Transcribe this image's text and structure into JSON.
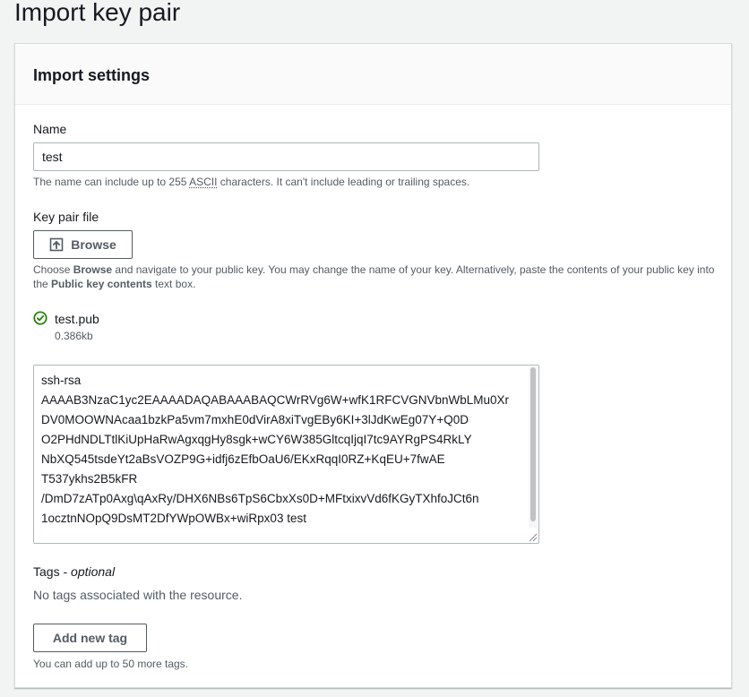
{
  "page": {
    "title": "Import key pair"
  },
  "settings": {
    "title": "Import settings"
  },
  "name_field": {
    "label": "Name",
    "value": "test",
    "hint_prefix": "The name can include up to 255 ",
    "hint_abbr": "ASCII",
    "hint_suffix": " characters. It can't include leading or trailing spaces."
  },
  "key_file": {
    "label": "Key pair file",
    "browse_label": "Browse",
    "help_prefix": "Choose ",
    "help_browse": "Browse",
    "help_middle": " and navigate to your public key. You may change the name of your key. Alternatively, paste the contents of your public key into the ",
    "help_public_key": "Public key contents",
    "help_suffix": " text box.",
    "file_name": "test.pub",
    "file_size": "0.386kb",
    "contents": "ssh-rsa\nAAAAB3NzaC1yc2EAAAADAQABAAABAQCWrRVg6W+wfK1RFCVGNVbnWbLMu0Xr\nDV0MOOWNAcaa1bzkPa5vm7mxhE0dVirA8xiTvgEBy6KI+3lJdKwEg07Y+Q0D\nO2PHdNDLTtlKiUpHaRwAgxqgHy8sgk+wCY6W385GltcqIjqI7tc9AYRgPS4RkLY\nNbXQ545tsdeYt2aBsVOZP9G+idfj6zEfbOaU6/EKxRqqI0RZ+KqEU+7fwAE\nT537ykhs2B5kFR\n/DmD7zATp0Axg\\qAxRy/DHX6NBs6TpS6CbxXs0D+MFtxixvVd6fKGyTXhfoJCt6n\n1ocztnNOpQ9DsMT2DfYWpOWBx+wiRpx03 test"
  },
  "tags": {
    "label": "Tags",
    "optional": "optional",
    "empty_text": "No tags associated with the resource.",
    "add_label": "Add new tag",
    "limit_text": "You can add up to 50 more tags."
  },
  "colors": {
    "success": "#1d8102",
    "border": "#aab7b8",
    "text": "#16191f",
    "secondary_text": "#545b64"
  }
}
